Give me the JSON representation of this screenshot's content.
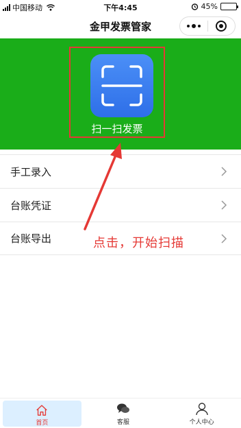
{
  "status_bar": {
    "carrier": "中国移动",
    "time": "下午4:45",
    "battery_percent_label": "45%",
    "battery_level": 0.45
  },
  "nav": {
    "title": "金甲发票管家"
  },
  "banner": {
    "scan_label": "扫一扫发票",
    "color": "#1aad19"
  },
  "menu": {
    "items": [
      {
        "label": "手工录入"
      },
      {
        "label": "台账凭证"
      },
      {
        "label": "台账导出"
      }
    ]
  },
  "annotation": {
    "text": "点击，开始扫描",
    "color": "#e53935"
  },
  "tabbar": {
    "tabs": [
      {
        "label": "首页",
        "icon": "home-icon",
        "active": true
      },
      {
        "label": "客服",
        "icon": "chat-icon",
        "active": false
      },
      {
        "label": "个人中心",
        "icon": "user-icon",
        "active": false
      }
    ]
  }
}
